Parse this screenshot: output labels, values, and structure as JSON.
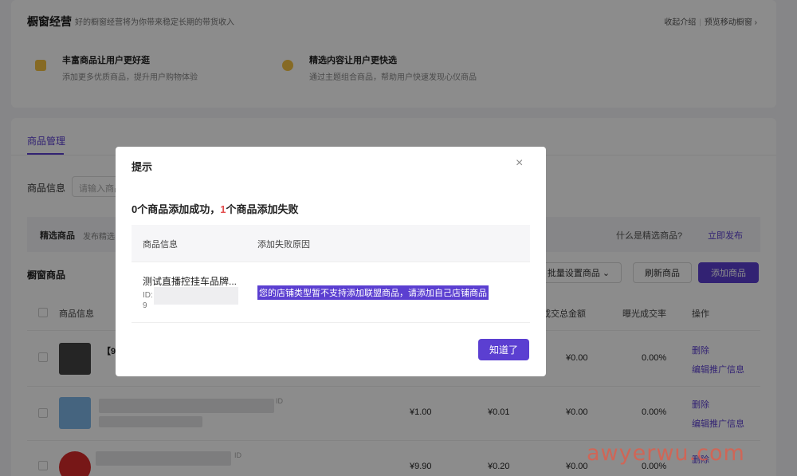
{
  "header": {
    "title": "橱窗经营",
    "subtitle": "好的橱窗经营将为你带来稳定长期的带货收入",
    "link_intro": "收起介绍",
    "link_preview": "预览移动橱窗",
    "features": [
      {
        "title": "丰富商品让用户更好逛",
        "desc": "添加更多优质商品，提升用户购物体验"
      },
      {
        "title": "精选内容让用户更快选",
        "desc": "通过主题组合商品，帮助用户快速发现心仪商品"
      }
    ]
  },
  "tabs": {
    "active": "商品管理"
  },
  "filter": {
    "label": "商品信息",
    "placeholder": "请输入商品"
  },
  "picked": {
    "title": "精选商品",
    "sub": "发布精选",
    "what_link": "什么是精选商品?",
    "publish_link": "立即发布"
  },
  "section": {
    "title": "橱窗商品",
    "batch_btn": "批量设置商品",
    "refresh_btn": "刷新商品",
    "add_btn": "添加商品"
  },
  "table": {
    "headers": {
      "info": "商品信息",
      "gmv": "成交总金额",
      "ctr": "曝光成交率",
      "ops": "操作"
    },
    "rows": [
      {
        "title": "【9.",
        "price": "",
        "commission": "",
        "gmv": "¥0.00",
        "ctr": "0.00%",
        "op1": "删除",
        "op2": "编辑推广信息",
        "thumb_color": "#444444"
      },
      {
        "title": "",
        "id_label": "ID",
        "price": "¥1.00",
        "commission": "¥0.01",
        "gmv": "¥0.00",
        "ctr": "0.00%",
        "op1": "删除",
        "op2": "编辑推广信息",
        "thumb_color": "#7fb6e8"
      },
      {
        "title": "",
        "id_label": "ID",
        "price": "¥9.90",
        "commission": "¥0.20",
        "gmv": "¥0.00",
        "ctr": "0.00%",
        "op1": "删除",
        "op2": "编辑推广信息",
        "thumb_color": "#d92b2b"
      }
    ]
  },
  "modal": {
    "title": "提示",
    "close": "×",
    "summary_pre": "0个商品添加成功，",
    "summary_fail_count": "1",
    "summary_post": "个商品添加失败",
    "col_info": "商品信息",
    "col_reason": "添加失败原因",
    "item_name": "测试直播控挂车品牌...",
    "item_id_label": "ID:",
    "item_id_tail": "9",
    "reason": "您的店铺类型暂不支持添加联盟商品，请添加自己店铺商品",
    "ok_btn": "知道了"
  },
  "watermark": "awyerwu.com"
}
